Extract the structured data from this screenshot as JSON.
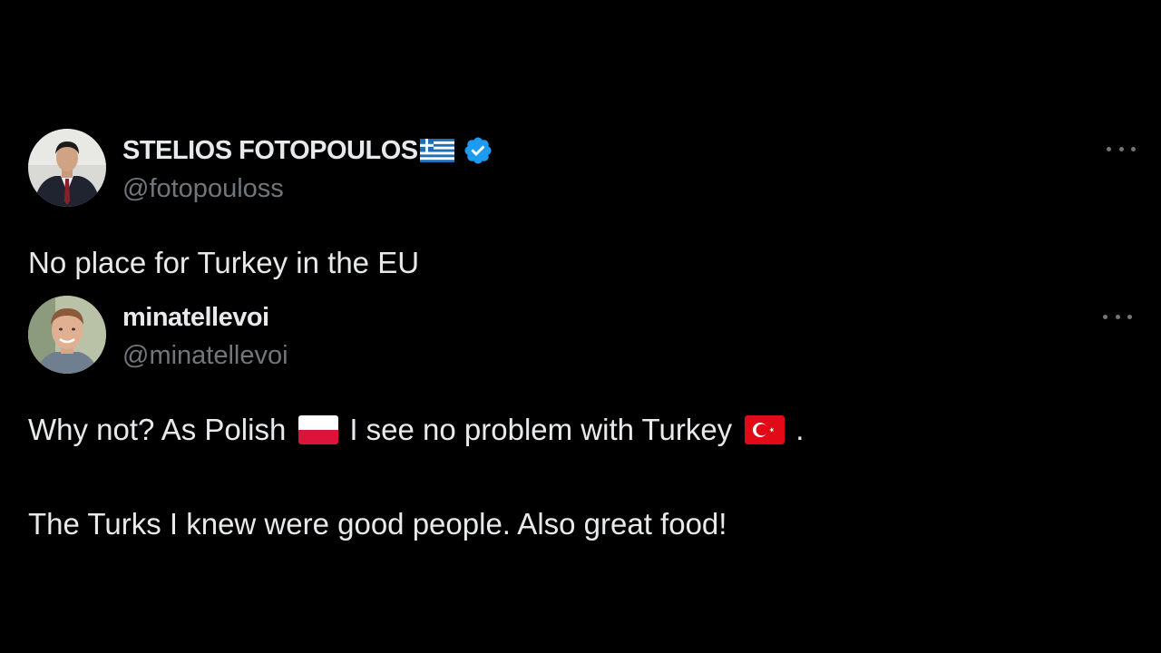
{
  "tweets": [
    {
      "display_name": "STELIOS FOTOPOULOS",
      "name_flag_icon": "greece-flag-emoji",
      "verified": true,
      "handle": "@fotopouloss",
      "text": "No place for Turkey in the EU"
    },
    {
      "display_name": "minatellevoi",
      "verified": false,
      "handle": "@minatellevoi",
      "text_line_1": {
        "part_1": "Why not? As Polish",
        "flag_1": "poland-flag-emoji",
        "part_2": "I see no problem with Turkey",
        "flag_2": "turkey-flag-emoji",
        "part_3": "."
      },
      "text_line_2": "The Turks I knew were good people. Also great food!"
    }
  ],
  "colors": {
    "background": "#000000",
    "primary_text": "#e7e9ea",
    "secondary_text": "#71767b",
    "verified_blue": "#1d9bf0"
  }
}
